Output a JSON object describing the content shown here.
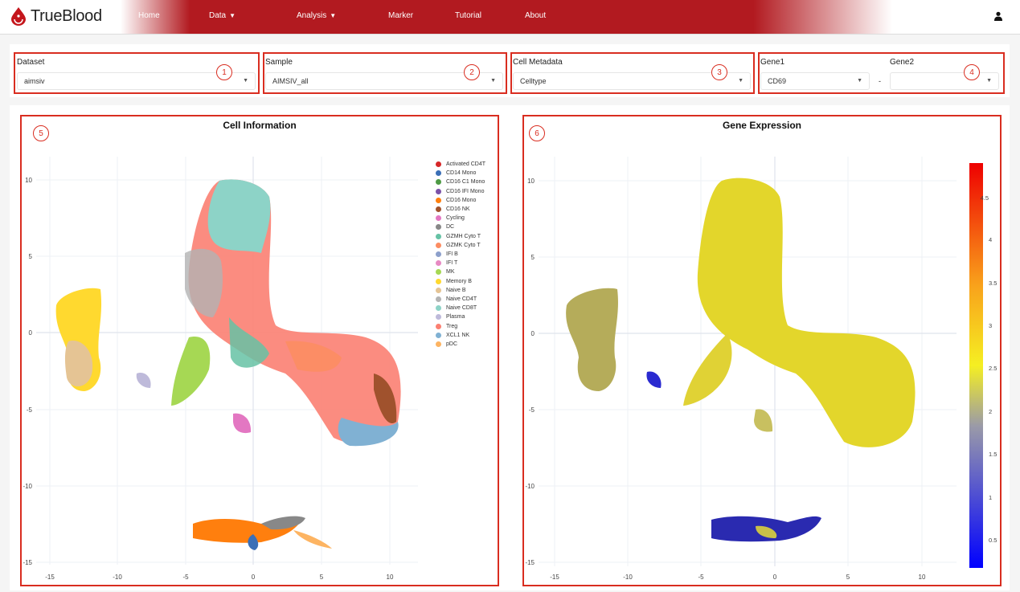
{
  "app": {
    "name": "TrueBlood"
  },
  "nav": {
    "items": [
      {
        "label": "Home"
      },
      {
        "label": "Data"
      },
      {
        "label": "Analysis"
      },
      {
        "label": "Marker"
      },
      {
        "label": "Tutorial"
      },
      {
        "label": "About"
      }
    ]
  },
  "controls": {
    "dataset": {
      "label": "Dataset",
      "value": "aimsiv",
      "badge": "1"
    },
    "sample": {
      "label": "Sample",
      "value": "AIMSIV_all",
      "badge": "2"
    },
    "metadata": {
      "label": "Cell Metadata",
      "value": "Celltype",
      "badge": "3"
    },
    "gene": {
      "label1": "Gene1",
      "label2": "Gene2",
      "value1": "CD69",
      "value2": "",
      "separator": "-",
      "badge": "4"
    }
  },
  "cell_info": {
    "title": "Cell Information",
    "badge": "5",
    "legend": [
      {
        "name": "Activated CD4T",
        "color": "#d62728"
      },
      {
        "name": "CD14 Mono",
        "color": "#3b6fb6"
      },
      {
        "name": "CD16 C1 Mono",
        "color": "#4e9a45"
      },
      {
        "name": "CD16 IFI Mono",
        "color": "#7b52a8"
      },
      {
        "name": "CD16 Mono",
        "color": "#ff7f0e"
      },
      {
        "name": "CD16 NK",
        "color": "#a0522d"
      },
      {
        "name": "Cycling",
        "color": "#e377c2"
      },
      {
        "name": "DC",
        "color": "#888888"
      },
      {
        "name": "GZMH Cyto T",
        "color": "#66c2a5"
      },
      {
        "name": "GZMK Cyto T",
        "color": "#fc8d62"
      },
      {
        "name": "IFI B",
        "color": "#8da0cb"
      },
      {
        "name": "IFI T",
        "color": "#e78ac3"
      },
      {
        "name": "MK",
        "color": "#a6d854"
      },
      {
        "name": "Memory B",
        "color": "#ffd92f"
      },
      {
        "name": "Naive B",
        "color": "#e5c494"
      },
      {
        "name": "Naive CD4T",
        "color": "#b3b3b3"
      },
      {
        "name": "Naive CD8T",
        "color": "#8dd3c7"
      },
      {
        "name": "Plasma",
        "color": "#bebada"
      },
      {
        "name": "Treg",
        "color": "#fb8072"
      },
      {
        "name": "XCL1 NK",
        "color": "#80b1d3"
      },
      {
        "name": "pDC",
        "color": "#fdb462"
      }
    ],
    "x_ticks": [
      "-15",
      "-10",
      "-5",
      "0",
      "5",
      "10"
    ],
    "y_ticks": [
      "10",
      "5",
      "0",
      "-5",
      "-10",
      "-15"
    ]
  },
  "gene_expr": {
    "title": "Gene Expression",
    "badge": "6",
    "x_ticks": [
      "-15",
      "-10",
      "-5",
      "0",
      "5",
      "10"
    ],
    "y_ticks": [
      "10",
      "5",
      "0",
      "-5",
      "-10",
      "-15"
    ],
    "colorbar_ticks": [
      "4.5",
      "4",
      "3.5",
      "3",
      "2.5",
      "2",
      "1.5",
      "1",
      "0.5"
    ]
  }
}
